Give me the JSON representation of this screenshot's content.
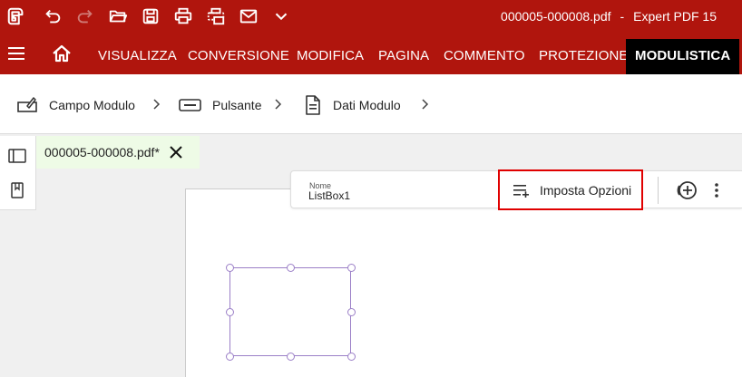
{
  "titlebar": {
    "filename": "000005-000008.pdf",
    "separator": "-",
    "app_name": "Expert PDF 15",
    "icons": [
      "app-logo-icon",
      "undo-icon",
      "redo-icon",
      "open-folder-icon",
      "save-icon",
      "print-icon",
      "scan-icon",
      "email-icon",
      "chevron-down-icon"
    ]
  },
  "menu": {
    "tabs": [
      "VISUALIZZA",
      "CONVERSIONE",
      "MODIFICA",
      "PAGINA",
      "COMMENTO",
      "PROTEZIONE",
      "MODULISTICA"
    ],
    "active": "MODULISTICA"
  },
  "ribbon": {
    "items": [
      {
        "label": "Campo Modulo",
        "icon": "form-field-icon"
      },
      {
        "label": "Pulsante",
        "icon": "button-field-icon"
      },
      {
        "label": "Dati Modulo",
        "icon": "form-data-icon"
      }
    ]
  },
  "document": {
    "tab_title": "000005-000008.pdf*"
  },
  "properties": {
    "name_label": "Nome",
    "name_value": "ListBox1",
    "options_button": "Imposta Opzioni"
  },
  "colors": {
    "brand": "#b0150d",
    "active_tab": "#000000",
    "highlight": "#e00000",
    "selection": "#9b7fc7",
    "doc_tab_bg": "#eefbe6"
  }
}
